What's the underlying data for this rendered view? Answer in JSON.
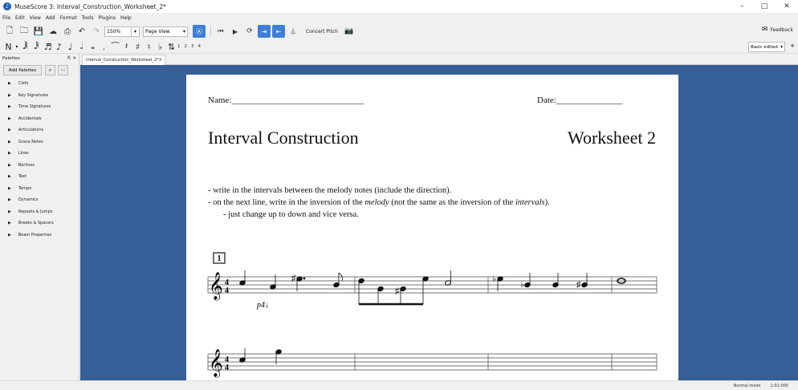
{
  "window": {
    "title": "MuseScore 3: Interval_Construction_Worksheet_2*",
    "minimize": "–",
    "maximize": "□",
    "close": "✕"
  },
  "menu": [
    "File",
    "Edit",
    "View",
    "Add",
    "Format",
    "Tools",
    "Plugins",
    "Help"
  ],
  "toolbar": {
    "zoom": "150%",
    "view_mode": "Page View",
    "concert_pitch": "Concert Pitch",
    "feedback": "Feedback"
  },
  "note_input": {
    "voices": [
      "1",
      "2",
      "3",
      "4"
    ],
    "workspace": "Basic edited"
  },
  "palettes": {
    "header": "Palettes",
    "add_button": "Add Palettes",
    "items": [
      "Clefs",
      "Key Signatures",
      "Time Signatures",
      "Accidentals",
      "Articulations",
      "Grace Notes",
      "Lines",
      "Barlines",
      "Text",
      "Tempo",
      "Dynamics",
      "Repeats & Jumps",
      "Breaks & Spacers",
      "Beam Properties"
    ]
  },
  "tab": {
    "label": "Interval_Construction_Worksheet_2*",
    "close": "✕"
  },
  "score": {
    "name_field": "Name:______________________________",
    "date_field": "Date:_______________",
    "title": "Interval Construction",
    "subtitle": "Worksheet 2",
    "instructions": [
      "- write in the intervals between the melody notes (include the direction).",
      "- on the next line, write in the inversion of the melody (not the same as the inversion of the intervals).",
      "- just change up to down and vice versa."
    ],
    "rehearsal_mark": "1",
    "annotation": "p4↓"
  },
  "status": {
    "mode": "Normal mode",
    "time": "1:01:000"
  }
}
